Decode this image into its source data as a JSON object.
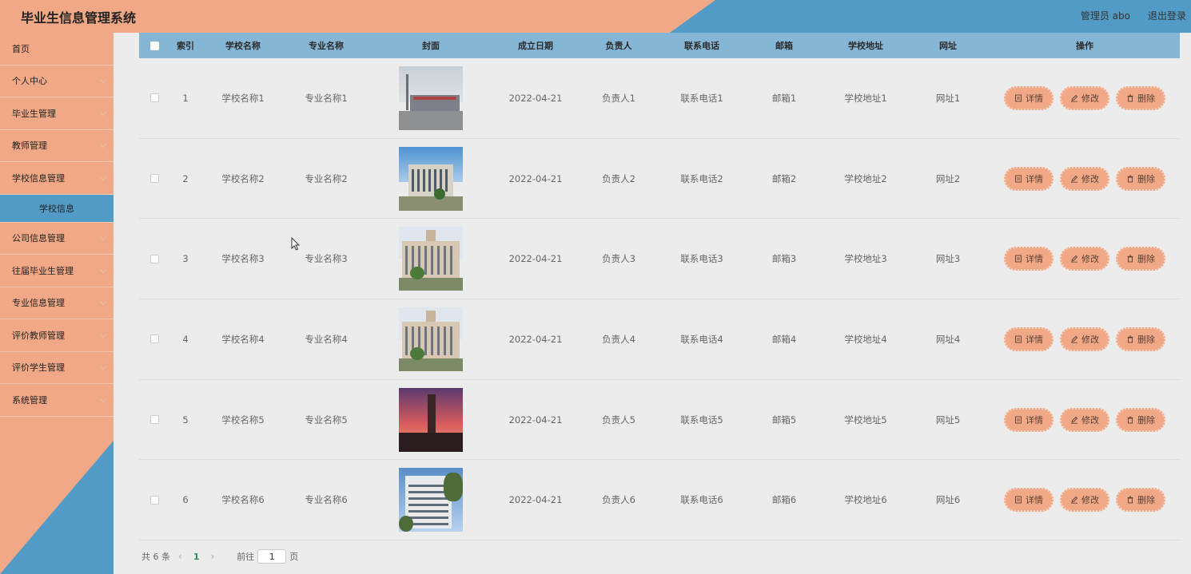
{
  "header": {
    "title": "毕业生信息管理系统",
    "user": "管理员 abo",
    "logout": "退出登录",
    "colors": {
      "orange": "#f0a886",
      "blue": "#539bc7"
    }
  },
  "sidebar": {
    "items": [
      {
        "label": "首页",
        "chev": false
      },
      {
        "label": "个人中心",
        "chev": true
      },
      {
        "label": "毕业生管理",
        "chev": true
      },
      {
        "label": "教师管理",
        "chev": true
      },
      {
        "label": "学校信息管理",
        "chev": true
      },
      {
        "label": "公司信息管理",
        "chev": true
      },
      {
        "label": "往届毕业生管理",
        "chev": true
      },
      {
        "label": "专业信息管理",
        "chev": true
      },
      {
        "label": "评价教师管理",
        "chev": true
      },
      {
        "label": "评价学生管理",
        "chev": true
      },
      {
        "label": "系统管理",
        "chev": true
      }
    ],
    "active_sub": "学校信息"
  },
  "table": {
    "headers": {
      "index": "索引",
      "school": "学校名称",
      "major": "专业名称",
      "cover": "封面",
      "date": "成立日期",
      "owner": "负责人",
      "phone": "联系电话",
      "mail": "邮箱",
      "addr": "学校地址",
      "url": "网址",
      "ops": "操作"
    },
    "rows": [
      {
        "index": "1",
        "school": "学校名称1",
        "major": "专业名称1",
        "date": "2022-04-21",
        "owner": "负责人1",
        "phone": "联系电话1",
        "mail": "邮箱1",
        "addr": "学校地址1",
        "url": "网址1"
      },
      {
        "index": "2",
        "school": "学校名称2",
        "major": "专业名称2",
        "date": "2022-04-21",
        "owner": "负责人2",
        "phone": "联系电话2",
        "mail": "邮箱2",
        "addr": "学校地址2",
        "url": "网址2"
      },
      {
        "index": "3",
        "school": "学校名称3",
        "major": "专业名称3",
        "date": "2022-04-21",
        "owner": "负责人3",
        "phone": "联系电话3",
        "mail": "邮箱3",
        "addr": "学校地址3",
        "url": "网址3"
      },
      {
        "index": "4",
        "school": "学校名称4",
        "major": "专业名称4",
        "date": "2022-04-21",
        "owner": "负责人4",
        "phone": "联系电话4",
        "mail": "邮箱4",
        "addr": "学校地址4",
        "url": "网址4"
      },
      {
        "index": "5",
        "school": "学校名称5",
        "major": "专业名称5",
        "date": "2022-04-21",
        "owner": "负责人5",
        "phone": "联系电话5",
        "mail": "邮箱5",
        "addr": "学校地址5",
        "url": "网址5"
      },
      {
        "index": "6",
        "school": "学校名称6",
        "major": "专业名称6",
        "date": "2022-04-21",
        "owner": "负责人6",
        "phone": "联系电话6",
        "mail": "邮箱6",
        "addr": "学校地址6",
        "url": "网址6"
      }
    ],
    "actions": {
      "detail": "详情",
      "edit": "修改",
      "delete": "删除"
    }
  },
  "pager": {
    "total": "共 6 条",
    "current": "1",
    "goto_label": "前往",
    "goto_value": "1",
    "page_unit": "页"
  }
}
